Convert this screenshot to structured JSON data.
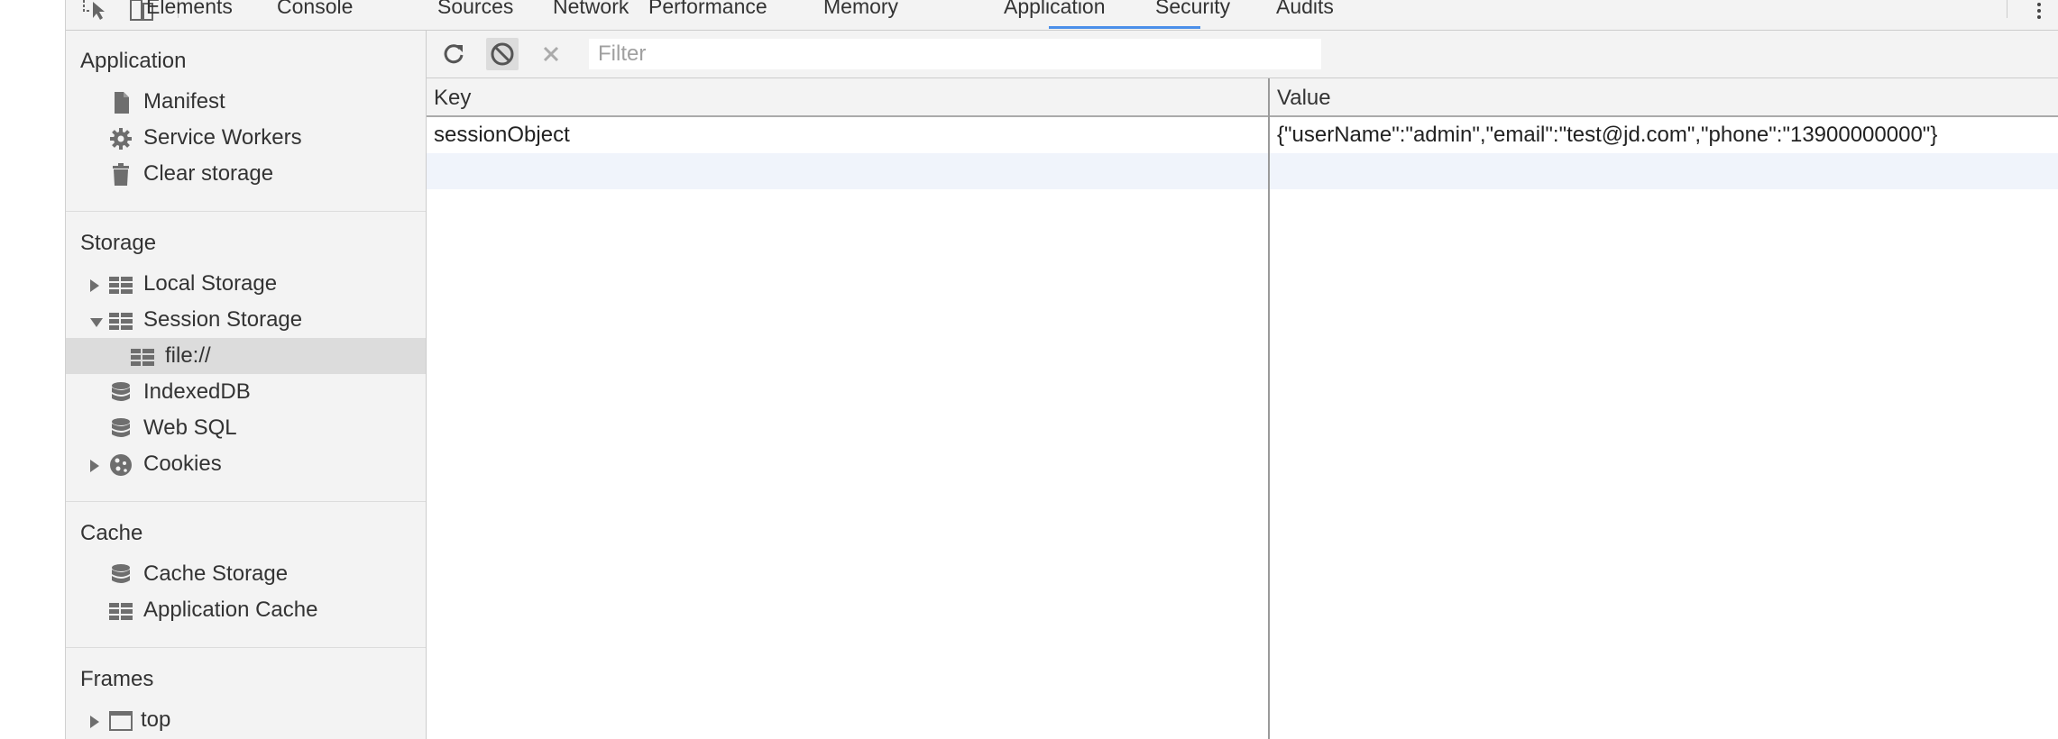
{
  "tabs": [
    {
      "label": "Elements",
      "name": "tab-elements"
    },
    {
      "label": "Console",
      "name": "tab-console"
    },
    {
      "label": "Sources",
      "name": "tab-sources"
    },
    {
      "label": "Network",
      "name": "tab-network"
    },
    {
      "label": "Performance",
      "name": "tab-performance"
    },
    {
      "label": "Memory",
      "name": "tab-memory"
    },
    {
      "label": "Application",
      "name": "tab-application"
    },
    {
      "label": "Security",
      "name": "tab-security"
    },
    {
      "label": "Audits",
      "name": "tab-audits"
    }
  ],
  "active_tab": "Application",
  "sidebar": {
    "application": {
      "title": "Application",
      "items": [
        {
          "label": "Manifest",
          "icon": "document-icon"
        },
        {
          "label": "Service Workers",
          "icon": "gear-icon"
        },
        {
          "label": "Clear storage",
          "icon": "trash-icon"
        }
      ]
    },
    "storage": {
      "title": "Storage",
      "items": [
        {
          "label": "Local Storage",
          "icon": "grid-icon",
          "expander": "collapsed"
        },
        {
          "label": "Session Storage",
          "icon": "grid-icon",
          "expander": "expanded"
        },
        {
          "label": "file://",
          "icon": "grid-icon",
          "selected": true
        },
        {
          "label": "IndexedDB",
          "icon": "database-icon"
        },
        {
          "label": "Web SQL",
          "icon": "database-icon"
        },
        {
          "label": "Cookies",
          "icon": "cookie-icon",
          "expander": "collapsed"
        }
      ]
    },
    "cache": {
      "title": "Cache",
      "items": [
        {
          "label": "Cache Storage",
          "icon": "database-icon"
        },
        {
          "label": "Application Cache",
          "icon": "grid-icon"
        }
      ]
    },
    "frames": {
      "title": "Frames",
      "items": [
        {
          "label": "top",
          "icon": "frame-icon",
          "expander": "collapsed"
        }
      ]
    }
  },
  "toolbar": {
    "filter_placeholder": "Filter",
    "refresh_icon": "refresh-icon",
    "clear_all_icon": "block-icon",
    "delete_icon": "close-icon"
  },
  "table": {
    "columns": [
      "Key",
      "Value"
    ],
    "rows": [
      {
        "key": "sessionObject",
        "value": "{\"userName\":\"admin\",\"email\":\"test@jd.com\",\"phone\":\"13900000000\"}"
      }
    ]
  },
  "colors": {
    "accent": "#4b8fe9",
    "panel_bg": "#f3f3f3",
    "selected_bg": "#dcdcdc"
  }
}
